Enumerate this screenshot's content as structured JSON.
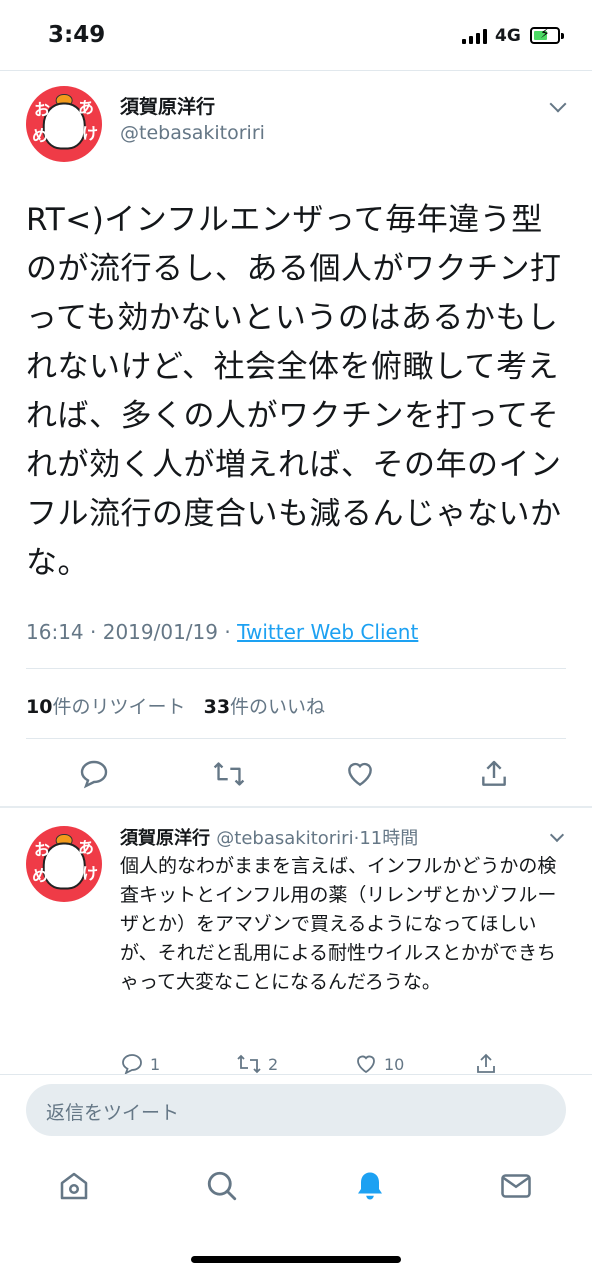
{
  "status_bar": {
    "time": "3:49",
    "network": "4G"
  },
  "main_tweet": {
    "display_name": "須賀原洋行",
    "handle": "@tebasakitoriri",
    "avatar_text": [
      "お",
      "め",
      "あ",
      "け"
    ],
    "text": "RT<)インフルエンザって毎年違う型のが流行るし、ある個人がワクチン打っても効かないというのはあるかもしれないけど、社会全体を俯瞰して考えれば、多くの人がワクチンを打ってそれが効く人が増えれば、その年のインフル流行の度合いも減るんじゃないかな。",
    "time": "16:14",
    "date": "2019/01/19",
    "client": "Twitter Web Client",
    "retweets_count": "10",
    "retweets_label": "件のリツイート",
    "likes_count": "33",
    "likes_label": "件のいいね"
  },
  "reply_tweet": {
    "display_name": "須賀原洋行",
    "handle": "@tebasakitoriri",
    "age": "11時間",
    "text": "個人的なわがままを言えば、インフルかどうかの検査キットとインフル用の薬（リレンザとかゾフルーザとか）をアマゾンで買えるようになってほしいが、それだと乱用による耐性ウイルスとかができちゃって大変なことになるんだろうな。",
    "reply_count": "1",
    "retweet_count": "2",
    "like_count": "10"
  },
  "compose": {
    "placeholder": "返信をツイート"
  },
  "icons": {
    "main_actions": [
      "reply-icon",
      "retweet-icon",
      "like-icon",
      "share-icon"
    ],
    "tabs": [
      "home-icon",
      "search-icon",
      "notifications-icon",
      "messages-icon"
    ]
  },
  "colors": {
    "link": "#1da1f2",
    "secondary_text": "#657786",
    "avatar_bg": "#ef3b47",
    "active_tab": "#1da1f2"
  }
}
